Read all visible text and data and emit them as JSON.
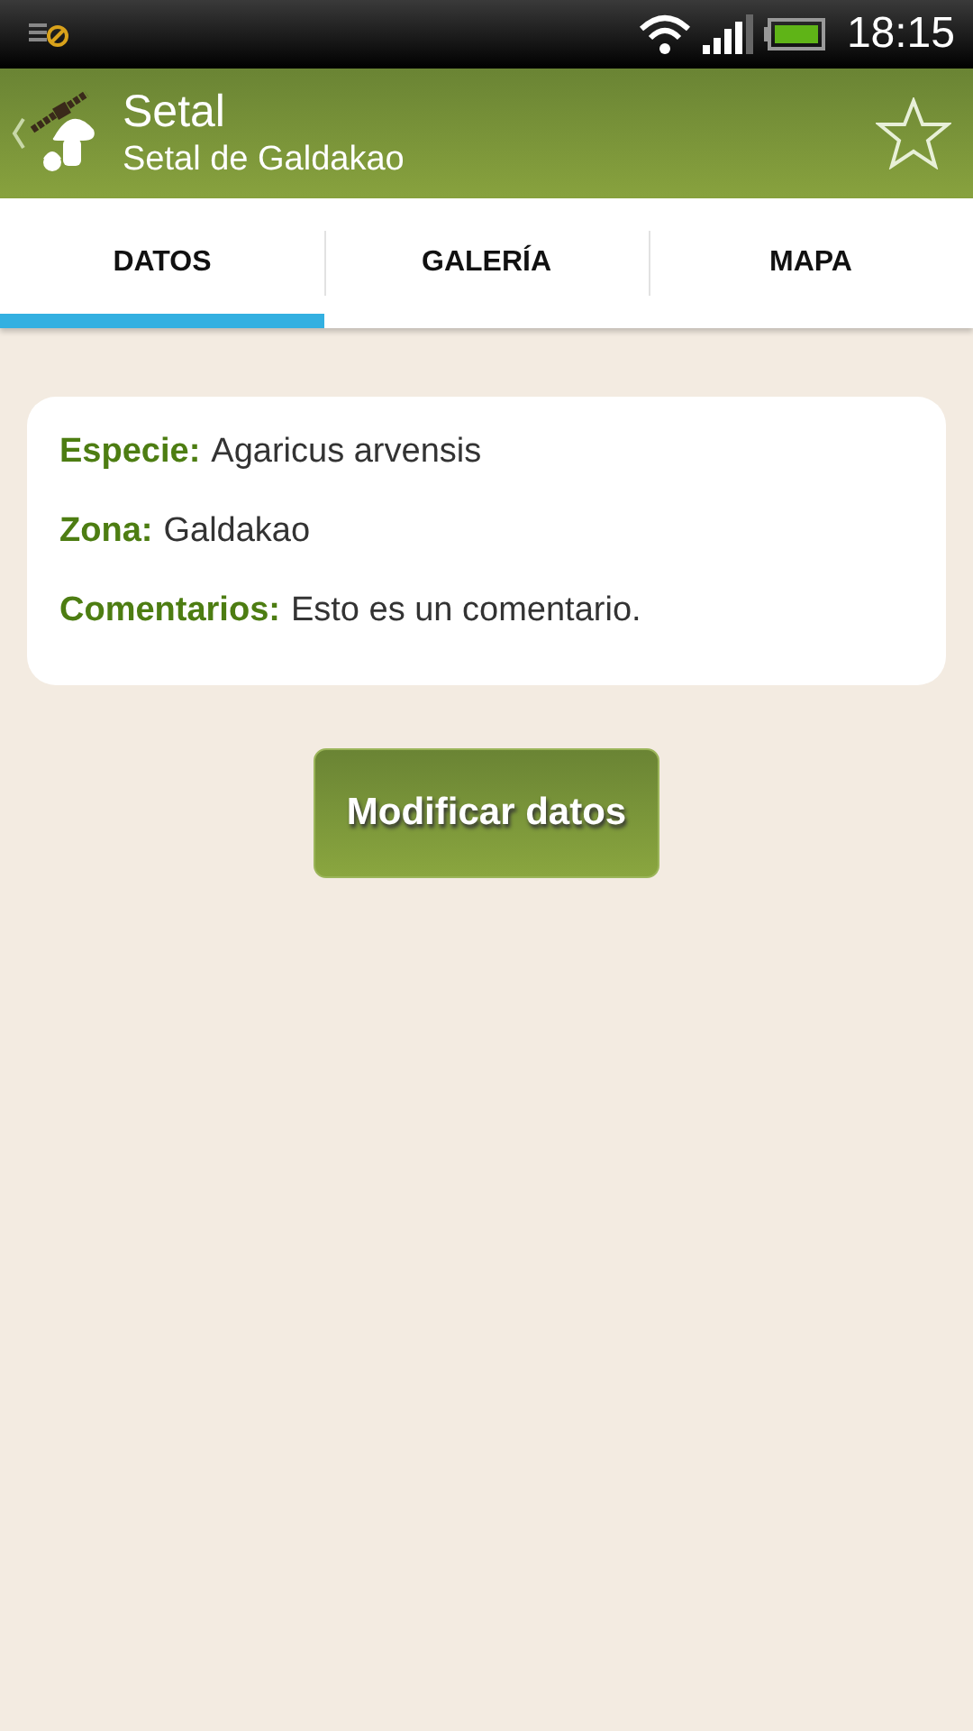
{
  "status_bar": {
    "time": "18:15"
  },
  "action_bar": {
    "title": "Setal",
    "subtitle": "Setal de Galdakao",
    "favorite": false
  },
  "tabs": [
    {
      "label": "DATOS",
      "selected": true
    },
    {
      "label": "GALERÍA",
      "selected": false
    },
    {
      "label": "MAPA",
      "selected": false
    }
  ],
  "details": [
    {
      "label": "Especie:",
      "value": "Agaricus arvensis"
    },
    {
      "label": "Zona:",
      "value": "Galdakao"
    },
    {
      "label": "Comentarios:",
      "value": "Esto es un comentario."
    }
  ],
  "button": "Modificar datos"
}
